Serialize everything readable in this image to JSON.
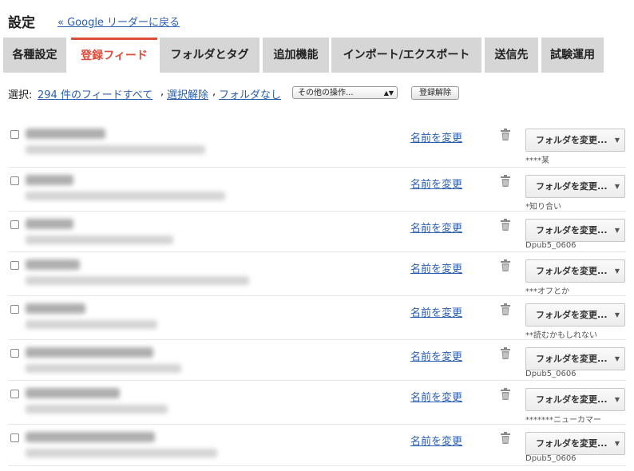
{
  "header": {
    "title": "設定",
    "back_link": "« Google リーダーに戻る"
  },
  "tabs": [
    {
      "label": "各種設定",
      "active": false
    },
    {
      "label": "登録フィード",
      "active": true
    },
    {
      "label": "フォルダとタグ",
      "active": false
    },
    {
      "label": "追加機能",
      "active": false
    },
    {
      "label": "インポート/エクスポート",
      "active": false
    },
    {
      "label": "送信先",
      "active": false
    },
    {
      "label": "試験運用",
      "active": false
    }
  ],
  "toolbar": {
    "prefix": "選択:",
    "select_all": "294 件のフィードすべて",
    "deselect": "選択解除",
    "no_folder": "フォルダなし",
    "more_actions": "その他の操作...",
    "unsubscribe": "登録解除"
  },
  "feeds": [
    {
      "rename": "名前を変更",
      "folder_button": "フォルダを変更...",
      "folder": "****某"
    },
    {
      "rename": "名前を変更",
      "folder_button": "フォルダを変更...",
      "folder": "*知り合い"
    },
    {
      "rename": "名前を変更",
      "folder_button": "フォルダを変更...",
      "folder": "Dpub5_0606"
    },
    {
      "rename": "名前を変更",
      "folder_button": "フォルダを変更...",
      "folder": "***オフとか"
    },
    {
      "rename": "名前を変更",
      "folder_button": "フォルダを変更...",
      "folder": "**読むかもしれない"
    },
    {
      "rename": "名前を変更",
      "folder_button": "フォルダを変更...",
      "folder": "Dpub5_0606"
    },
    {
      "rename": "名前を変更",
      "folder_button": "フォルダを変更...",
      "folder": "*******ニューカマー"
    },
    {
      "rename": "名前を変更",
      "folder_button": "フォルダを変更...",
      "folder": "Dpub5_0606"
    }
  ],
  "colors": {
    "accent": "#dd4b39",
    "link": "#2a5db0",
    "tab_bg": "#d6d6d6"
  },
  "icons": {
    "trash": "trash-icon",
    "dropdown": "chevron-down-icon"
  }
}
